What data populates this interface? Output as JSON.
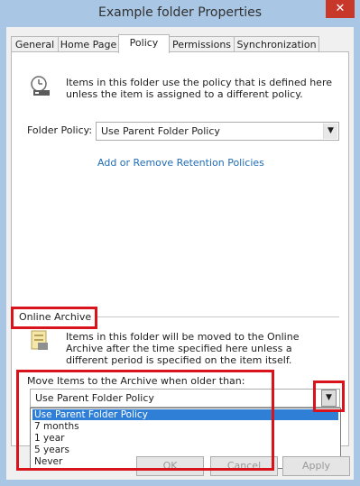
{
  "window": {
    "title": "Example folder Properties",
    "close_glyph": "✕"
  },
  "tabs": [
    {
      "label": "General"
    },
    {
      "label": "Home Page"
    },
    {
      "label": "Policy"
    },
    {
      "label": "Permissions"
    },
    {
      "label": "Synchronization"
    }
  ],
  "policy": {
    "description": "Items in this folder use the policy that is defined here unless the item is assigned to a different policy.",
    "folder_policy_label": "Folder Policy:",
    "folder_policy_value": "Use Parent Folder Policy",
    "link_label": "Add or Remove Retention Policies"
  },
  "archive": {
    "section_label": "Online Archive",
    "description": "Items in this folder will be moved to the Online Archive after the time specified here unless a different period is specified on the item itself.",
    "move_label": "Move Items to the Archive when older than:",
    "selected_value": "Use Parent Folder Policy",
    "options": [
      "Use Parent Folder Policy",
      "7 months",
      "1 year",
      "5 years",
      "Never"
    ]
  },
  "buttons": {
    "ok": "OK",
    "cancel": "Cancel",
    "apply": "Apply"
  },
  "colors": {
    "highlight": "#d9131c",
    "selection": "#2f7fd6",
    "link": "#1f6cb6"
  }
}
